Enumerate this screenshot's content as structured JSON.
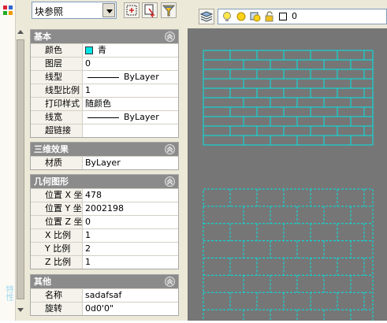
{
  "toolbar": {
    "selection_type": "块参照",
    "quick_select_icon": "quick-select-icon",
    "select_objects_icon": "select-objects-icon",
    "toggle_pickadd_icon": "filter-funnel-icon"
  },
  "side_strip": {
    "label": "特性"
  },
  "sections": {
    "general": {
      "title": "基本",
      "rows": [
        {
          "name": "颜色",
          "value": "青",
          "swatch": "#00e5e5"
        },
        {
          "name": "图层",
          "value": "0"
        },
        {
          "name": "线型",
          "value": "ByLayer"
        },
        {
          "name": "线型比例",
          "value": "1"
        },
        {
          "name": "打印样式",
          "value": "随颜色"
        },
        {
          "name": "线宽",
          "value": "ByLayer"
        },
        {
          "name": "超链接",
          "value": ""
        }
      ]
    },
    "3d": {
      "title": "三维效果",
      "rows": [
        {
          "name": "材质",
          "value": "ByLayer"
        }
      ]
    },
    "geometry": {
      "title": "几何图形",
      "rows": [
        {
          "name": "位置 X 坐标",
          "value": "478"
        },
        {
          "name": "位置 Y 坐标",
          "value": "2002198"
        },
        {
          "name": "位置 Z 坐标",
          "value": "0"
        },
        {
          "name": "X 比例",
          "value": "1"
        },
        {
          "name": "Y 比例",
          "value": "2"
        },
        {
          "name": "Z 比例",
          "value": "1"
        }
      ]
    },
    "misc": {
      "title": "其他",
      "rows": [
        {
          "name": "名称",
          "value": "sadafsaf"
        },
        {
          "name": "旋转",
          "value": "0d0'0\""
        }
      ]
    }
  },
  "layer_toolbar": {
    "current_layer": "0",
    "layer_color": "#ffffff",
    "icons": [
      "layer-manager-icon",
      "lightbulb-icon",
      "sun-icon",
      "viewport-freeze-icon",
      "lock-icon"
    ]
  },
  "drawing": {
    "background": "#767676",
    "hatch_color": "#00e5e5"
  }
}
